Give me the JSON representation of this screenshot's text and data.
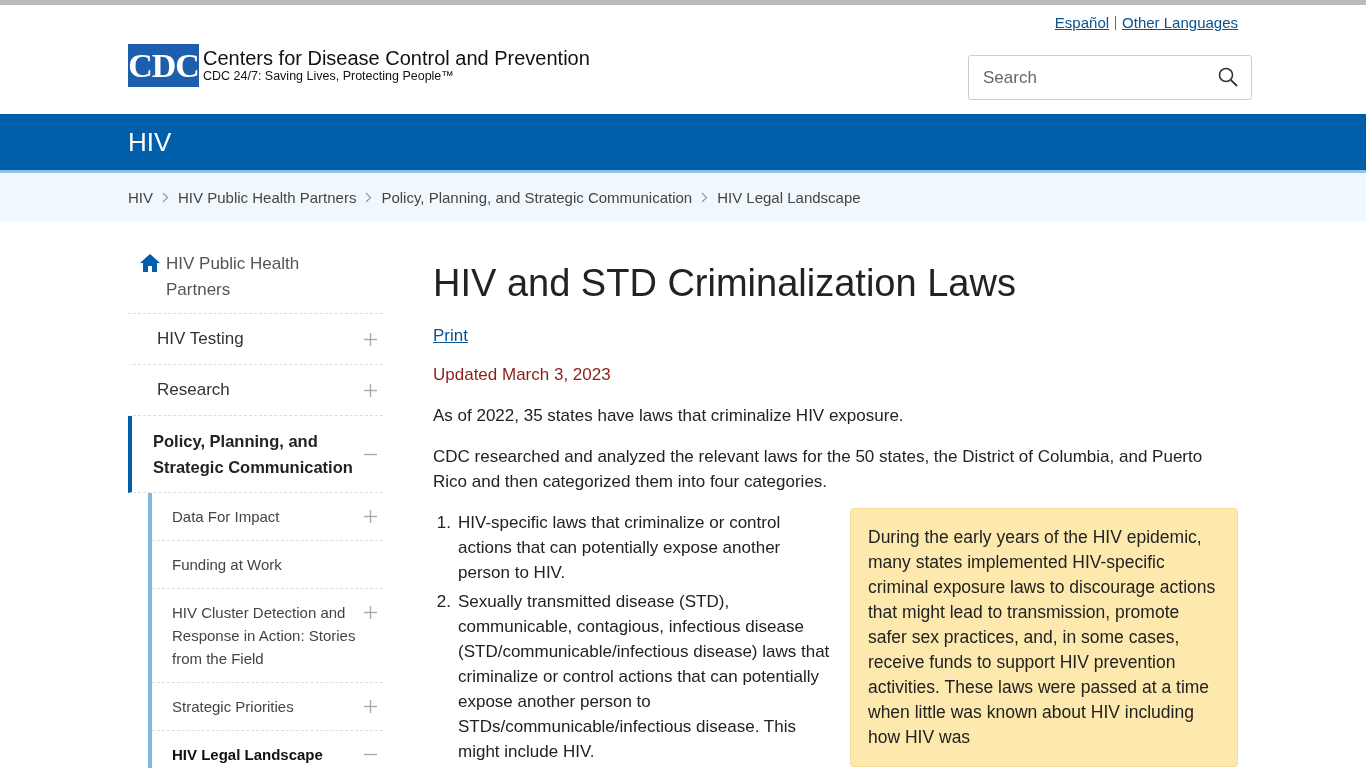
{
  "top_links": [
    {
      "label": "Español"
    },
    {
      "label": "Other Languages"
    }
  ],
  "logo": {
    "mark": "CDC",
    "title": "Centers for Disease Control and Prevention",
    "tagline": "CDC 24/7: Saving Lives, Protecting People™"
  },
  "search": {
    "placeholder": "Search"
  },
  "site_title": "HIV",
  "breadcrumbs": [
    "HIV",
    "HIV Public Health Partners",
    "Policy, Planning, and Strategic Communication",
    "HIV Legal Landscape"
  ],
  "sidebar": {
    "home": "HIV Public Health Partners",
    "items": [
      {
        "label": "HIV Testing",
        "expanded": false,
        "selected": false
      },
      {
        "label": "Research",
        "expanded": false,
        "selected": false
      },
      {
        "label": "Policy, Planning, and Strategic Communication",
        "expanded": true,
        "selected": true,
        "children": [
          {
            "label": "Data For Impact",
            "expanded": false,
            "selected": false
          },
          {
            "label": "Funding at Work",
            "selected": false
          },
          {
            "label": "HIV Cluster Detection and Response in Action: Stories from the Field",
            "expanded": false,
            "selected": false
          },
          {
            "label": "Strategic Priorities",
            "expanded": false,
            "selected": false
          },
          {
            "label": "HIV Legal Landscape",
            "expanded": true,
            "selected": true
          }
        ]
      }
    ]
  },
  "article": {
    "title": "HIV and STD Criminalization Laws",
    "print": "Print",
    "updated": "Updated March 3, 2023",
    "paragraphs": [
      "As of 2022, 35 states have laws that criminalize HIV exposure.",
      "CDC researched and analyzed the relevant laws for the 50 states, the District of Columbia, and Puerto Rico and then categorized them into four categories."
    ],
    "list": [
      {
        "number": "1.",
        "text": "HIV-specific laws that criminalize or control actions that can potentially expose another person to HIV."
      },
      {
        "number": "2.",
        "text": "Sexually transmitted disease (STD), communicable, contagious, infectious disease (STD/communicable/infectious disease) laws that criminalize or control actions that can potentially expose another person to STDs/communicable/infectious disease. This might include HIV."
      }
    ],
    "callout": "During the early years of the HIV epidemic, many states implemented HIV-specific criminal exposure laws to discourage actions that might lead to transmission, promote safer sex practices, and, in some cases, receive funds to support HIV prevention activities. These laws were passed at a time when little was known about HIV including how HIV was"
  }
}
